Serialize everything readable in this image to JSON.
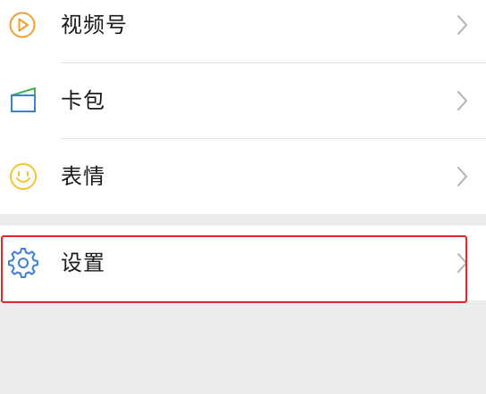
{
  "menu": {
    "items": [
      {
        "label": "视频号",
        "icon": "channels-play-icon",
        "color": "#f0a02c"
      },
      {
        "label": "卡包",
        "icon": "card-wallet-icon",
        "color": "#3b7fd6"
      },
      {
        "label": "表情",
        "icon": "sticker-smiley-icon",
        "color": "#f4c430"
      },
      {
        "label": "设置",
        "icon": "settings-gear-icon",
        "color": "#3b7fd6"
      }
    ]
  },
  "colors": {
    "highlight": "#e4262a",
    "background": "#ededed",
    "chevron": "#b2b2b2"
  }
}
